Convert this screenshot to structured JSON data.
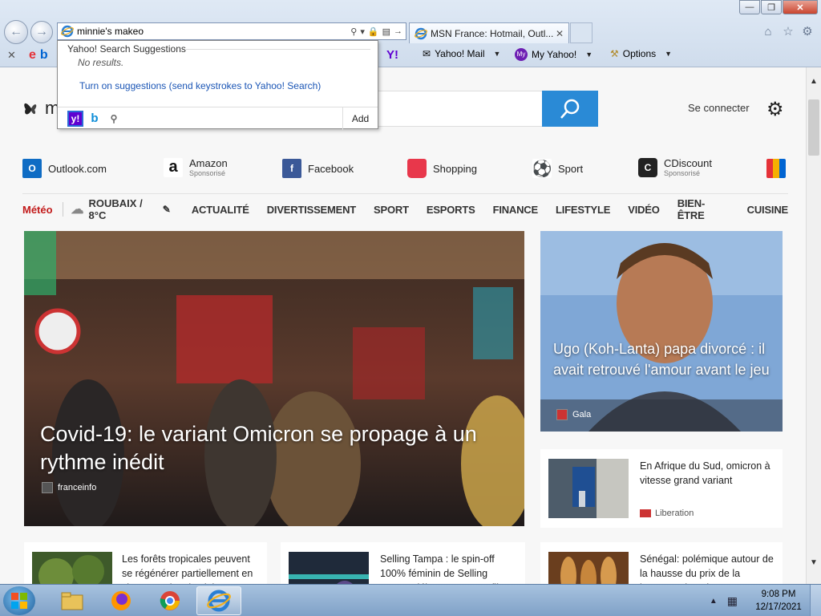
{
  "browser": {
    "address_text": "minnie's makeo",
    "tab_title": "MSN France: Hotmail, Outl...",
    "favorites": [
      {
        "label": "Yahoo! Mail",
        "icon": "mail-icon"
      },
      {
        "label": "My Yahoo!",
        "icon": "my-yahoo-icon"
      },
      {
        "label": "Options",
        "icon": "wrench-icon"
      }
    ]
  },
  "suggestions": {
    "header": "Yahoo! Search Suggestions",
    "no_results": "No results.",
    "turn_on": "Turn on suggestions (send keystrokes to Yahoo! Search)",
    "add": "Add"
  },
  "msn": {
    "signin": "Se connecter",
    "quicklinks": [
      {
        "label": "Outlook.com",
        "sub": ""
      },
      {
        "label": "Amazon",
        "sub": "Sponsorisé"
      },
      {
        "label": "Facebook",
        "sub": ""
      },
      {
        "label": "Shopping",
        "sub": ""
      },
      {
        "label": "Sport",
        "sub": ""
      },
      {
        "label": "CDiscount",
        "sub": "Sponsorisé"
      }
    ],
    "meteo": "Météo",
    "weather": "ROUBAIX / 8°C",
    "categories": [
      "ACTUALITÉ",
      "DIVERTISSEMENT",
      "SPORT",
      "ESPORTS",
      "FINANCE",
      "LIFESTYLE",
      "VIDÉO",
      "BIEN-ÊTRE",
      "CUISINE"
    ],
    "main_story": {
      "headline": "Covid-19: le variant Omicron se propage à un rythme inédit",
      "source": "franceinfo"
    },
    "side_story": {
      "headline": "Ugo (Koh-Lanta) papa divorcé : il avait retrouvé l'amour avant le jeu",
      "source": "Gala"
    },
    "small_stories": [
      {
        "title": "En Afrique du Sud, omicron à vitesse grand variant",
        "source": "Liberation"
      },
      {
        "title": "Les forêts tropicales peuvent se régénérer partiellement en vingt ans si on les laisse",
        "source": ""
      },
      {
        "title": "Selling Tampa : le spin-off 100% féminin de Selling Sunset débarque sur Netflix",
        "source": ""
      },
      {
        "title": "Sénégal: polémique autour de la hausse du prix de la baguette de pain",
        "source": ""
      }
    ]
  },
  "taskbar": {
    "time": "9:08 PM",
    "date": "12/17/2021"
  }
}
